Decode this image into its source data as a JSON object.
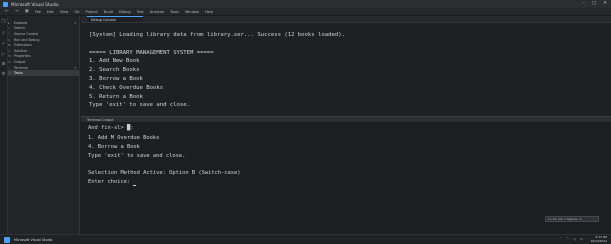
{
  "window": {
    "title": "Microsoft Visual Studio",
    "controls": [
      "–",
      "□",
      "✕"
    ]
  },
  "menubar": {
    "items": [
      "File",
      "Edit",
      "View",
      "Git",
      "Project",
      "Build",
      "Debug",
      "Test",
      "Analyze",
      "Tools",
      "Window",
      "Help"
    ]
  },
  "sidebar": {
    "items": [
      {
        "label": "Explorer",
        "icon": "folder-icon",
        "glyph": "▸"
      },
      {
        "label": "Search",
        "icon": "search-icon",
        "glyph": "⌕"
      },
      {
        "label": "Source Control",
        "icon": "branch-icon",
        "glyph": "⑂"
      },
      {
        "label": "Run and Debug",
        "icon": "play-icon",
        "glyph": "▷"
      },
      {
        "label": "Extensions",
        "icon": "extensions-icon",
        "glyph": "⊞"
      },
      {
        "label": "Solution",
        "icon": "solution-icon",
        "glyph": "◇"
      },
      {
        "label": "Properties",
        "icon": "wrench-icon",
        "glyph": "⚙"
      },
      {
        "label": "Output",
        "icon": "output-icon",
        "glyph": "≡"
      },
      {
        "label": "Terminal",
        "icon": "terminal-icon",
        "glyph": "›"
      },
      {
        "label": "Tasks",
        "icon": "tasks-icon",
        "glyph": "☐"
      }
    ],
    "active_index": 9
  },
  "editor": {
    "tab_label": "Debug Console",
    "lines": [
      "[System] Loading library data from library.ser... Success (12 books loaded).",
      "",
      "===== LIBRARY MANAGEMENT SYSTEM =====",
      "1. Add New Book",
      "2. Search Books",
      "3. Borrow a Book",
      "4. Check Overdue Books",
      "5. Return a Book",
      "Type 'exit' to save and close."
    ]
  },
  "panel": {
    "header": "Terminal Output",
    "prompt": "And fin-sl> █:",
    "lines": [
      "1. Add M Overdue Books",
      "4. Borrow a Book",
      "Type 'exit' to save and close.",
      "",
      "Selection Method Active: Option B (Switch-case)",
      "Enter choice: "
    ]
  },
  "status_chip": "Ln 12, Col 1  Spaces: 4",
  "taskbar": {
    "app_label": "Microsoft Visual Studio",
    "time": "4:32 PM",
    "date": "10/24/2024"
  }
}
